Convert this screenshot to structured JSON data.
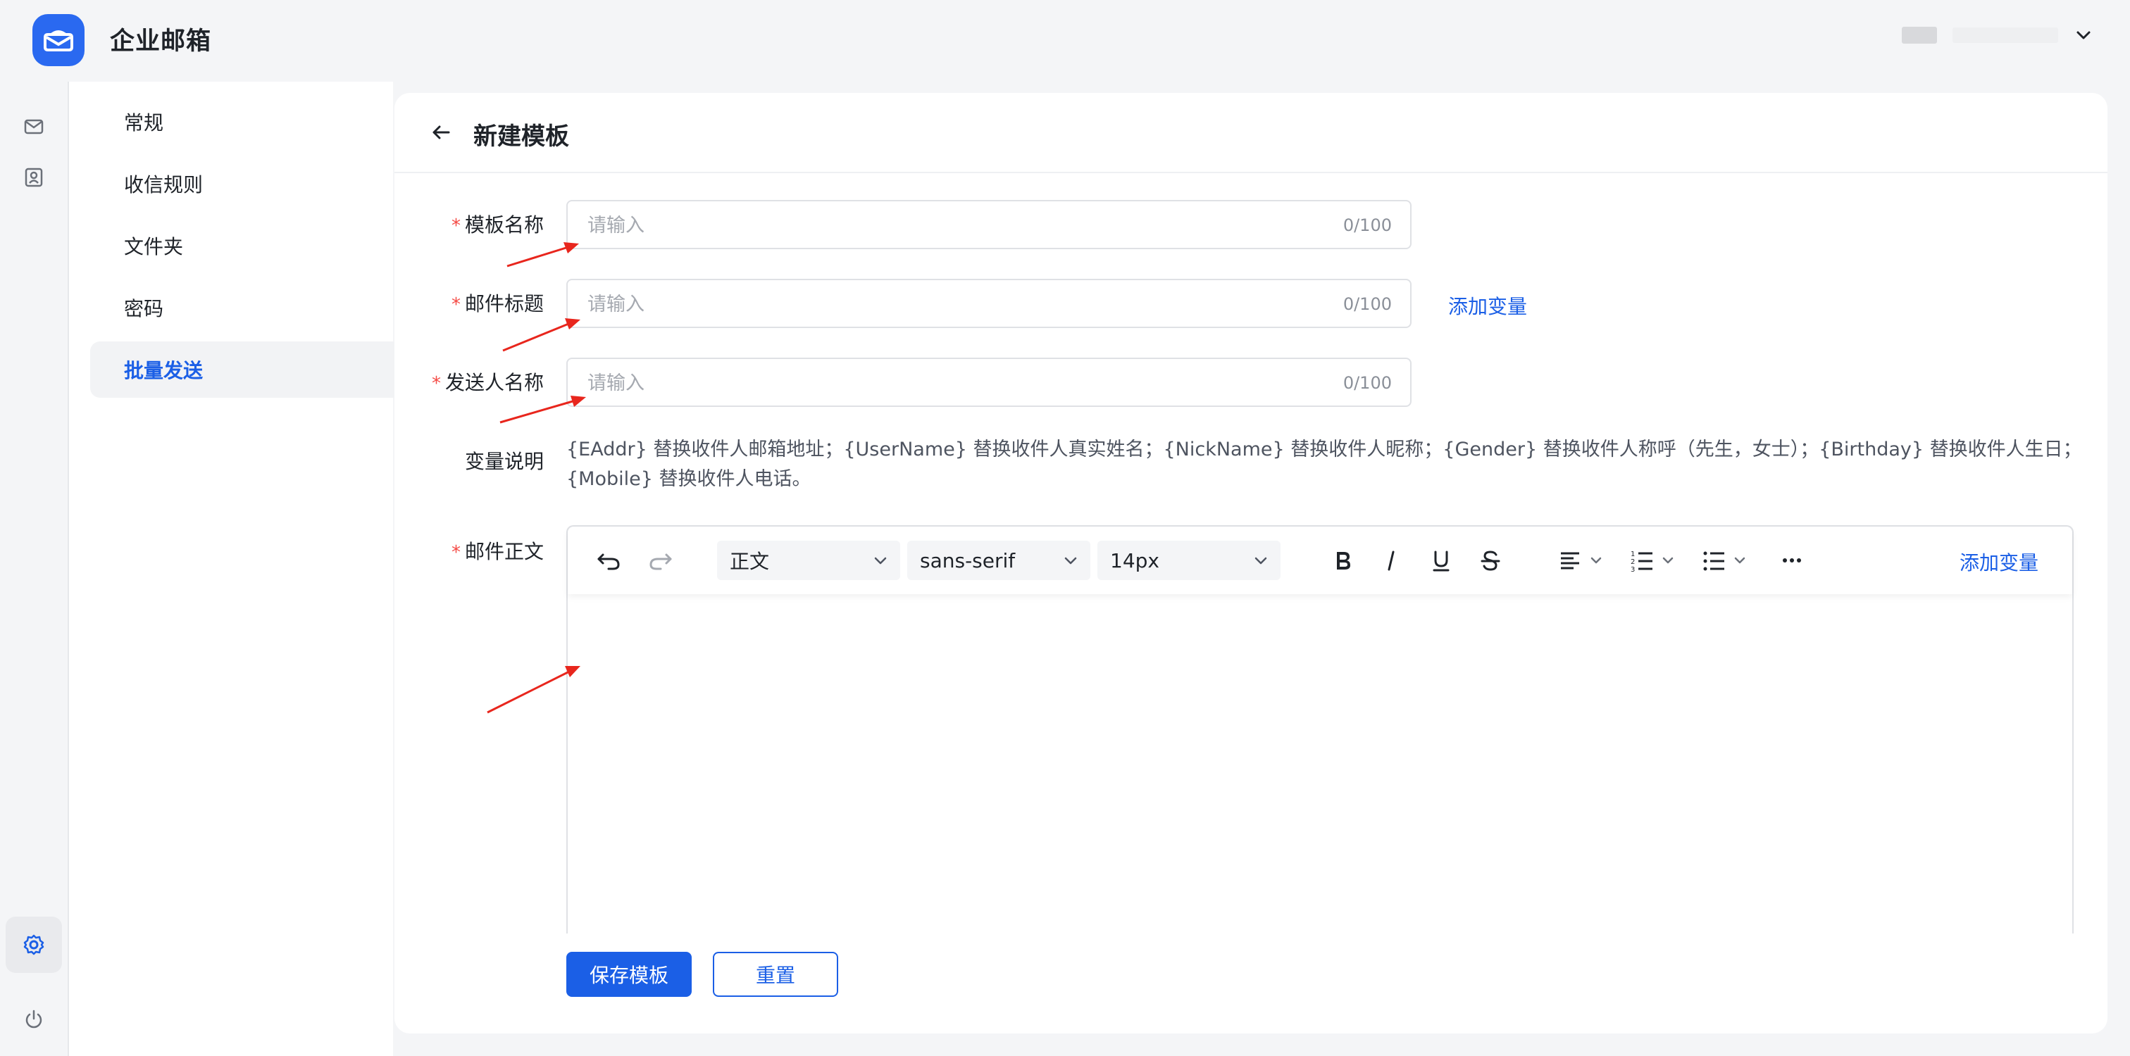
{
  "app": {
    "title": "企业邮箱"
  },
  "user": {
    "display": ""
  },
  "settings_nav": {
    "items": [
      {
        "label": "常规"
      },
      {
        "label": "收信规则"
      },
      {
        "label": "文件夹"
      },
      {
        "label": "密码"
      },
      {
        "label": "批量发送",
        "active": true
      }
    ]
  },
  "page": {
    "title": "新建模板"
  },
  "form": {
    "template_name": {
      "label": "模板名称",
      "placeholder": "请输入",
      "counter": "0/100",
      "required": true
    },
    "mail_subject": {
      "label": "邮件标题",
      "placeholder": "请输入",
      "counter": "0/100",
      "required": true,
      "add_variable": "添加变量"
    },
    "sender_name": {
      "label": "发送人名称",
      "placeholder": "请输入",
      "counter": "0/100",
      "required": true
    },
    "variables": {
      "label": "变量说明",
      "description": "{EAddr} 替换收件人邮箱地址；{UserName} 替换收件人真实姓名；{NickName} 替换收件人昵称；{Gender} 替换收件人称呼（先生，女士）；{Birthday} 替换收件人生日；{Mobile} 替换收件人电话。"
    },
    "body": {
      "label": "邮件正文",
      "required": true
    }
  },
  "editor": {
    "paragraph_style": "正文",
    "font_family": "sans-serif",
    "font_size": "14px",
    "add_variable": "添加变量",
    "icons": [
      "undo-icon",
      "redo-icon",
      "bold-icon",
      "italic-icon",
      "underline-icon",
      "strikethrough-icon",
      "align-icon",
      "ordered-list-icon",
      "bullet-list-icon",
      "more-icon"
    ]
  },
  "actions": {
    "save": "保存模板",
    "reset": "重置"
  },
  "colors": {
    "accent": "#1b5fe6",
    "required": "#f54a45",
    "annotation_arrow": "#e8261d"
  }
}
